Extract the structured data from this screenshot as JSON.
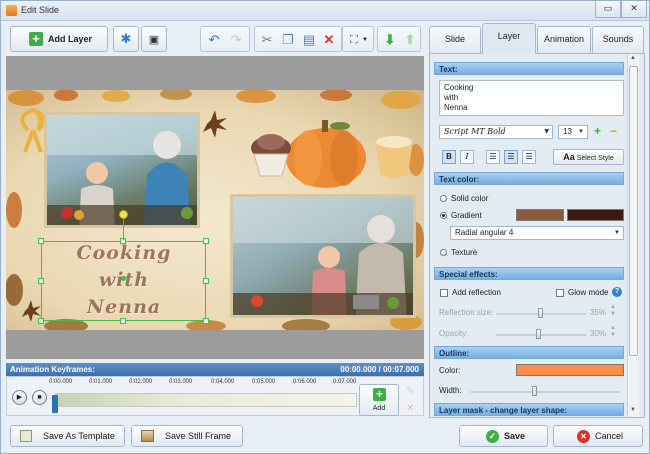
{
  "window": {
    "title": "Edit Slide",
    "minimize_glyph": "▭",
    "close_glyph": "✕"
  },
  "toolbar": {
    "add_layer_label": "Add Layer",
    "icons": [
      "plus-icon",
      "snowflake-effect-icon",
      "camera-icon",
      "undo-icon",
      "redo-icon",
      "cut-icon",
      "copy-icon",
      "paste-icon",
      "delete-icon",
      "fit-icon",
      "move-down-icon",
      "move-up-icon"
    ]
  },
  "tabs": {
    "slide": "Slide",
    "layer": "Layer",
    "animation": "Animation",
    "sounds": "Sounds"
  },
  "text_section": {
    "header": "Text:",
    "content_lines": [
      "Cooking",
      "with",
      "Nenna"
    ],
    "font_name": "Script MT Bold",
    "font_size": "13",
    "bold": "B",
    "italic": "I",
    "select_style_label": "Select Style",
    "select_style_glyph": "Aa"
  },
  "text_color": {
    "header": "Text color:",
    "solid_label": "Solid color",
    "gradient_label": "Gradient",
    "gradient_color_1": "#8a5a40",
    "gradient_color_2": "#3b1a10",
    "gradient_type": "Radial angular 4",
    "texture_label": "Texture",
    "selected": "gradient"
  },
  "special_effects": {
    "header": "Special effects:",
    "reflection_label": "Add reflection",
    "glow_label": "Glow mode",
    "reflection_size_label": "Reflection size:",
    "reflection_size_value": "35%",
    "opacity_label": "Opacity:",
    "opacity_value": "30%"
  },
  "outline": {
    "header": "Outline:",
    "color_label": "Color:",
    "color": "#ff8c4a",
    "width_label": "Width:"
  },
  "layer_mask": {
    "header": "Layer mask - change layer shape:"
  },
  "slide": {
    "title_lines": [
      "Cooking",
      "with",
      "Nenna"
    ]
  },
  "animation": {
    "header": "Animation Keyframes:",
    "time_display": "00:00.000 / 00:07.000",
    "ticks": [
      "0:00.000",
      "0:01.000",
      "0:02.000",
      "0:03.000",
      "0:04.000",
      "0:05.000",
      "0:06.000",
      "0:07.000"
    ],
    "add_label": "Add"
  },
  "footer": {
    "save_template_label": "Save As Template",
    "save_frame_label": "Save Still Frame",
    "save_label": "Save",
    "cancel_label": "Cancel"
  }
}
